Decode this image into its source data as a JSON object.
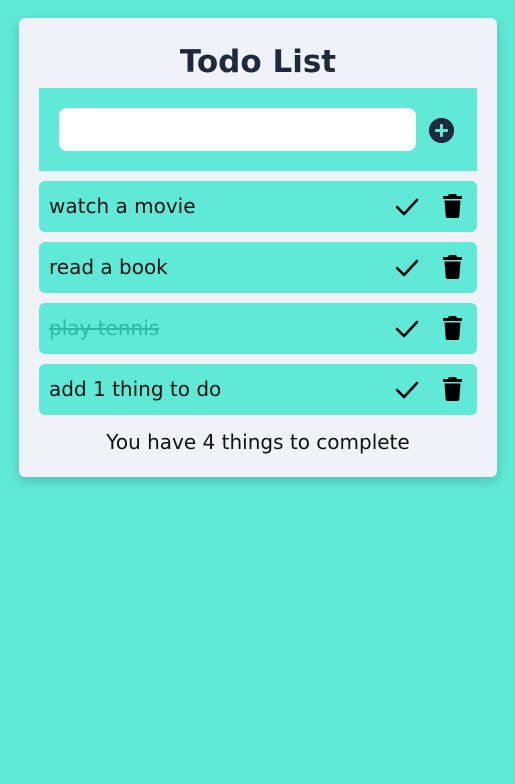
{
  "app": {
    "title": "Todo List"
  },
  "input": {
    "value": "",
    "placeholder": "",
    "add_icon": "plus-circle-icon"
  },
  "todos": [
    {
      "text": "watch a movie",
      "completed": false
    },
    {
      "text": "read a book",
      "completed": false
    },
    {
      "text": "play tennis",
      "completed": true
    },
    {
      "text": "add 1 thing to do",
      "completed": false
    }
  ],
  "item_icons": {
    "complete": "check-icon",
    "delete": "trash-icon"
  },
  "summary": {
    "text": "You have 4 things to complete"
  },
  "colors": {
    "background": "#60e9d7",
    "card": "#eff2f7",
    "dark": "#1e293b",
    "completed_text": "#2fb8a6"
  }
}
